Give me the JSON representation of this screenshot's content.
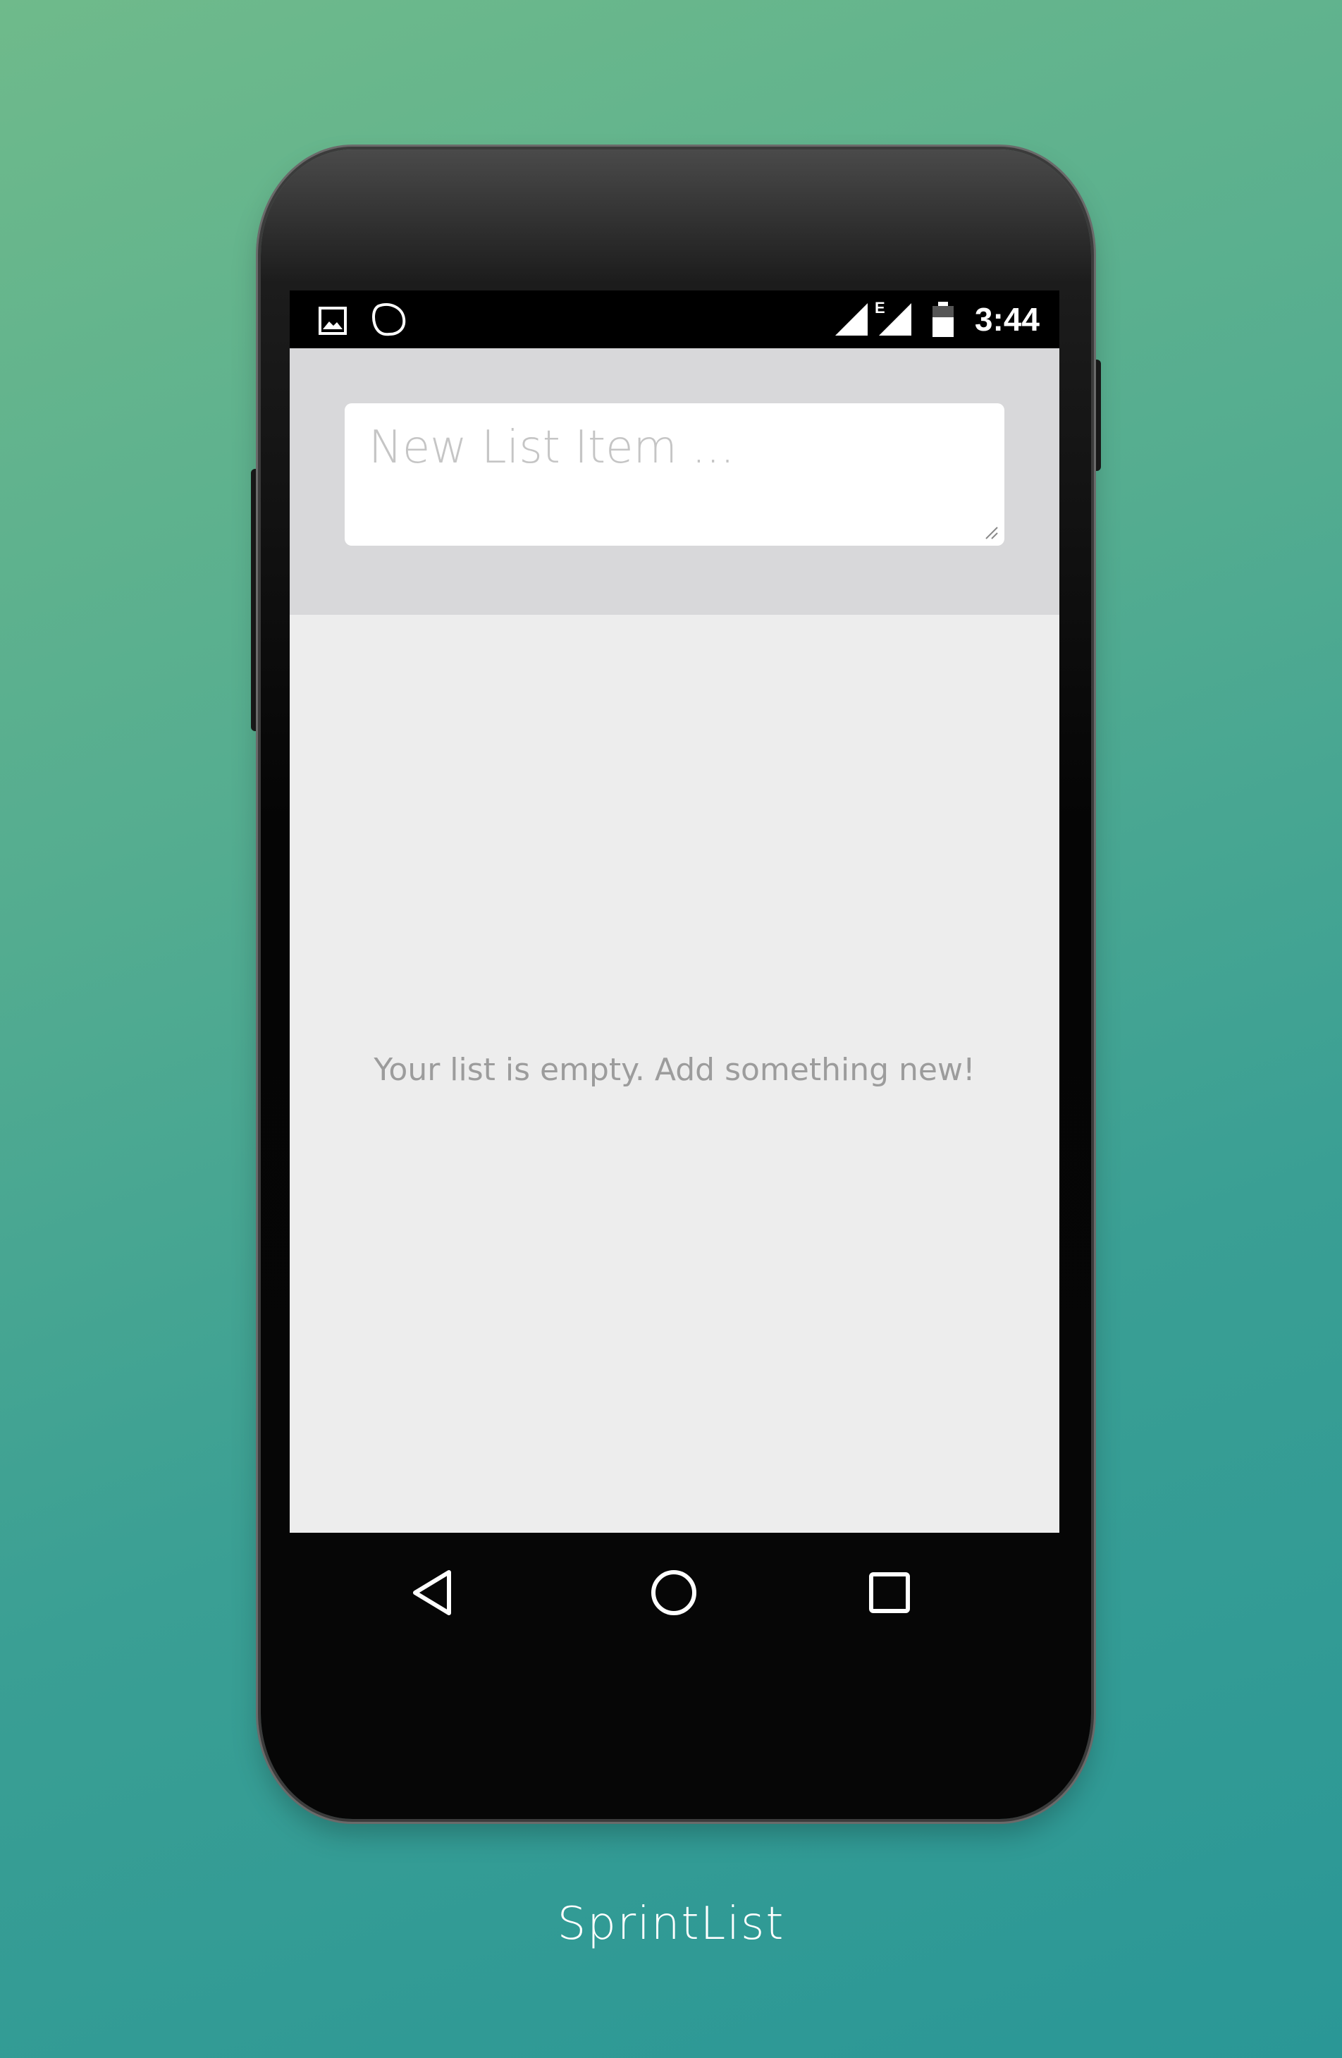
{
  "status_bar": {
    "left_icons": [
      "image-notification-icon",
      "hangouts-notification-icon"
    ],
    "network_type": "E",
    "time": "3:44"
  },
  "input": {
    "placeholder": "New List Item ...",
    "value": ""
  },
  "list": {
    "empty_message": "Your list is empty. Add something new!"
  },
  "nav_bar": {
    "buttons": [
      "back",
      "home",
      "recents"
    ]
  },
  "app": {
    "name": "SprintList"
  },
  "colors": {
    "background_start": "#6fba8b",
    "background_end": "#2a9796",
    "input_panel": "#d8d8da",
    "list_background": "#ededed",
    "status_bar": "#000000"
  }
}
